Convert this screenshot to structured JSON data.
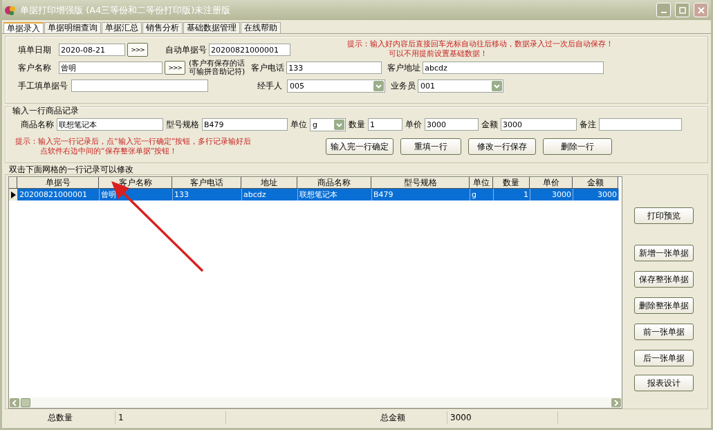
{
  "window": {
    "title": "单据打印增强版 (A4三等份和二等份打印版)未注册版"
  },
  "tabs": [
    {
      "label": "单据录入",
      "selected": true
    },
    {
      "label": "单据明细查询",
      "selected": false
    },
    {
      "label": "单据汇总",
      "selected": false
    },
    {
      "label": "销售分析",
      "selected": false
    },
    {
      "label": "基础数据管理",
      "selected": false
    },
    {
      "label": "在线帮助",
      "selected": false
    }
  ],
  "form": {
    "date_label": "填单日期",
    "date": "2020-08-21",
    "date_button": ">>>",
    "auto_no_label": "自动单据号",
    "auto_no": "20200821000001",
    "customer_label": "客户名称",
    "customer": "曾明",
    "customer_button": ">>>",
    "customer_hint": [
      "(客户有保存的话",
      "可输拼音助记符)"
    ],
    "phone_label": "客户电话",
    "phone": "133",
    "address_label": "客户地址",
    "address": "abcdz",
    "manual_no_label": "手工填单据号",
    "handler_label": "经手人",
    "handler": "005",
    "clerk_label": "业务员",
    "clerk": "001",
    "tip": [
      "提示：输入好内容后直接回车光标自动往后移动，数据录入过一次后自动保存！",
      "可以不用提前设置基础数据！"
    ]
  },
  "item_group": {
    "title": "输入一行商品记录",
    "fields": [
      {
        "label": "商品名称",
        "value": "联想笔记本",
        "kind": "text"
      },
      {
        "label": "型号规格",
        "value": "B479",
        "kind": "text"
      },
      {
        "label": "单位",
        "value": "g",
        "kind": "select"
      },
      {
        "label": "数量",
        "value": "1",
        "kind": "text"
      },
      {
        "label": "单价",
        "value": "3000",
        "kind": "text"
      },
      {
        "label": "金额",
        "value": "3000",
        "kind": "text"
      },
      {
        "label": "备注",
        "kind": "text"
      }
    ],
    "tip": [
      "提示：输入完一行记录后，点“输入完一行确定”按钮，多行记录输好后",
      "点软件右边中间的“保存整张单据”按钮！"
    ],
    "buttons": [
      "输入完一行确定",
      "重填一行",
      "修改一行保存",
      "删除一行"
    ]
  },
  "grid": {
    "caption": "双击下面网格的一行记录可以修改",
    "columns": [
      {
        "label": "单据号",
        "kind": "text"
      },
      {
        "label": "客户名称",
        "kind": "text"
      },
      {
        "label": "客户电话",
        "kind": "text"
      },
      {
        "label": "地址",
        "kind": "text"
      },
      {
        "label": "商品名称",
        "kind": "text"
      },
      {
        "label": "型号规格",
        "kind": "text"
      },
      {
        "label": "单位",
        "kind": "text"
      },
      {
        "label": "数量",
        "kind": "number"
      },
      {
        "label": "单价",
        "kind": "number"
      },
      {
        "label": "金额",
        "kind": "number"
      }
    ],
    "rows": [
      {
        "selected": true,
        "cells": [
          "20200821000001",
          "曾明",
          "133",
          "abcdz",
          "联想笔记本",
          "B479",
          "g",
          "1",
          "3000",
          "3000"
        ]
      }
    ]
  },
  "side_buttons": [
    "打印预览",
    "新增一张单据",
    "保存整张单据",
    "删除整张单据",
    "前一张单据",
    "后一张单据",
    "报表设计"
  ],
  "status_bar": [
    {
      "label": "总数量",
      "value": "1"
    },
    {
      "label": "总金额",
      "value": "3000"
    }
  ]
}
